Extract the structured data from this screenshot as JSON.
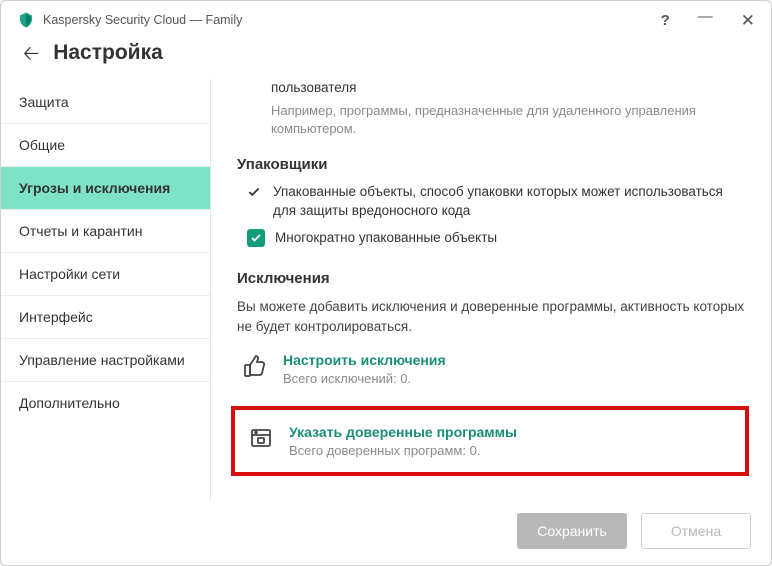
{
  "app": {
    "title": "Kaspersky Security Cloud — Family"
  },
  "header": {
    "pageTitle": "Настройка"
  },
  "sidebar": {
    "items": [
      {
        "label": "Защита"
      },
      {
        "label": "Общие"
      },
      {
        "label": "Угрозы и исключения"
      },
      {
        "label": "Отчеты и карантин"
      },
      {
        "label": "Настройки сети"
      },
      {
        "label": "Интерфейс"
      },
      {
        "label": "Управление настройками"
      },
      {
        "label": "Дополнительно"
      }
    ]
  },
  "content": {
    "topItem": {
      "title": "пользователя",
      "sub": "Например, программы, предназначенные для удаленного управления компьютером."
    },
    "packers": {
      "heading": "Упаковщики",
      "line1": "Упакованные объекты, способ упаковки которых может использоваться для защиты вредоносного кода",
      "line2": "Многократно упакованные объекты"
    },
    "exclusions": {
      "heading": "Исключения",
      "desc": "Вы можете добавить исключения и доверенные программы, активность которых не будет контролироваться.",
      "configure": {
        "label": "Настроить исключения",
        "sub": "Всего исключений: 0."
      },
      "trusted": {
        "label": "Указать доверенные программы",
        "sub": "Всего доверенных программ: 0."
      }
    }
  },
  "footer": {
    "save": "Сохранить",
    "cancel": "Отмена"
  }
}
